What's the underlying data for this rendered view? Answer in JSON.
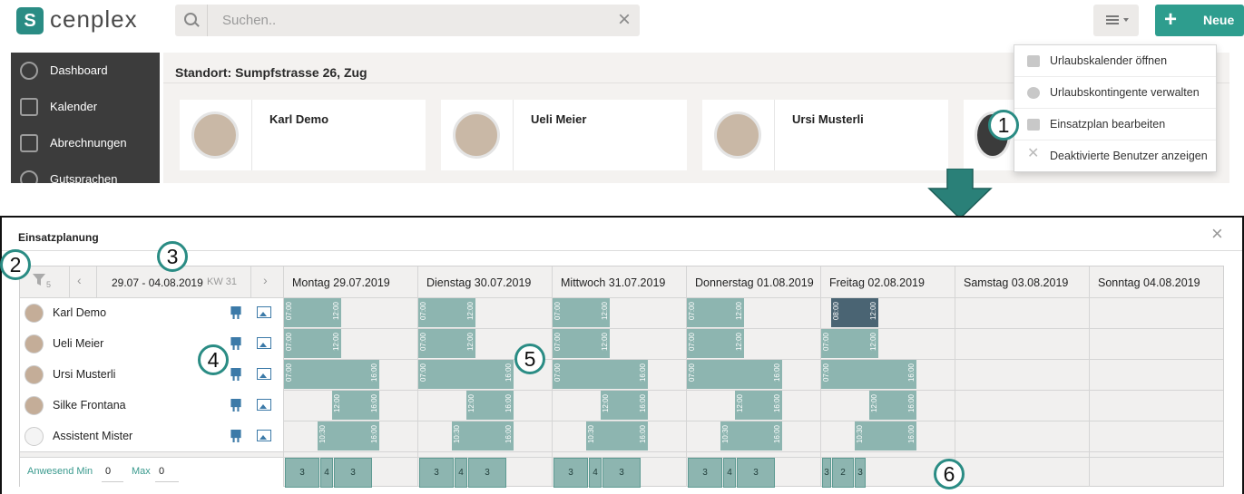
{
  "app": {
    "logo_text": "cenplex",
    "search_placeholder": "Suchen..",
    "new_label": "Neue"
  },
  "sidebar": {
    "items": [
      {
        "label": "Dashboard",
        "icon": "dashboard-icon"
      },
      {
        "label": "Kalender",
        "icon": "calendar-icon"
      },
      {
        "label": "Abrechnungen",
        "icon": "calculator-icon"
      },
      {
        "label": "Gutsprachen",
        "icon": "dollar-icon"
      }
    ]
  },
  "main": {
    "location": "Standort: Sumpfstrasse 26, Zug",
    "cards": [
      "Karl Demo",
      "Ueli  Meier",
      "Ursi Musterli"
    ]
  },
  "dropdown": {
    "items": [
      {
        "label": "Urlaubskalender öffnen",
        "icon": "calendar-icon"
      },
      {
        "label": "Urlaubskontingente verwalten",
        "icon": "gear-icon"
      },
      {
        "label": "Einsatzplan bearbeiten",
        "icon": "easel-icon"
      },
      {
        "label": "Deaktivierte Benutzer anzeigen",
        "icon": "close-icon"
      }
    ]
  },
  "badges": [
    "1",
    "2",
    "3",
    "4",
    "5",
    "6"
  ],
  "modal": {
    "title": "Einsatzplanung",
    "filter_count": "5",
    "date_range": "29.07 - 04.08.2019",
    "week": "KW 31",
    "days": [
      "Montag 29.07.2019",
      "Dienstag 30.07.2019",
      "Mittwoch 31.07.2019",
      "Donnerstag 01.08.2019",
      "Freitag 02.08.2019",
      "Samstag 03.08.2019",
      "Sonntag 04.08.2019"
    ],
    "employees": [
      {
        "name": "Karl Demo"
      },
      {
        "name": "Ueli  Meier"
      },
      {
        "name": "Ursi Musterli"
      },
      {
        "name": "Silke Frontana"
      },
      {
        "name": "Assistent Mister"
      }
    ],
    "present_min_label": "Anwesend Min",
    "present_min_value": "0",
    "max_label": "Max",
    "max_value": "0",
    "shifts": [
      {
        "row": 0,
        "day": 0,
        "start": "07:00",
        "end": "12:00"
      },
      {
        "row": 0,
        "day": 1,
        "start": "07:00",
        "end": "12:00"
      },
      {
        "row": 0,
        "day": 2,
        "start": "07:00",
        "end": "12:00"
      },
      {
        "row": 0,
        "day": 3,
        "start": "07:00",
        "end": "12:00"
      },
      {
        "row": 0,
        "day": 4,
        "start": "08:00",
        "end": "12:00",
        "dark": true
      },
      {
        "row": 1,
        "day": 0,
        "start": "07:00",
        "end": "12:00"
      },
      {
        "row": 1,
        "day": 1,
        "start": "07:00",
        "end": "12:00"
      },
      {
        "row": 1,
        "day": 2,
        "start": "07:00",
        "end": "12:00"
      },
      {
        "row": 1,
        "day": 3,
        "start": "07:00",
        "end": "12:00"
      },
      {
        "row": 1,
        "day": 4,
        "start": "07:00",
        "end": "12:00"
      },
      {
        "row": 2,
        "day": 0,
        "start": "07:00",
        "end": "16:00"
      },
      {
        "row": 2,
        "day": 1,
        "start": "07:00",
        "end": "16:00"
      },
      {
        "row": 2,
        "day": 2,
        "start": "07:00",
        "end": "16:00"
      },
      {
        "row": 2,
        "day": 3,
        "start": "07:00",
        "end": "16:00"
      },
      {
        "row": 2,
        "day": 4,
        "start": "07:00",
        "end": "16:00"
      },
      {
        "row": 3,
        "day": 0,
        "start": "12:00",
        "end": "16:00"
      },
      {
        "row": 3,
        "day": 1,
        "start": "12:00",
        "end": "16:00"
      },
      {
        "row": 3,
        "day": 2,
        "start": "12:00",
        "end": "16:00"
      },
      {
        "row": 3,
        "day": 3,
        "start": "12:00",
        "end": "16:00"
      },
      {
        "row": 3,
        "day": 4,
        "start": "12:00",
        "end": "16:00"
      },
      {
        "row": 4,
        "day": 0,
        "start": "10:30",
        "end": "16:00"
      },
      {
        "row": 4,
        "day": 1,
        "start": "10:30",
        "end": "16:00"
      },
      {
        "row": 4,
        "day": 2,
        "start": "10:30",
        "end": "16:00"
      },
      {
        "row": 4,
        "day": 3,
        "start": "10:30",
        "end": "16:00"
      },
      {
        "row": 4,
        "day": 4,
        "start": "10:30",
        "end": "16:00"
      }
    ],
    "counts": [
      [
        "3",
        "4",
        "3"
      ],
      [
        "3",
        "4",
        "3"
      ],
      [
        "3",
        "4",
        "3"
      ],
      [
        "3",
        "4",
        "3"
      ],
      [
        "3",
        "2",
        "3"
      ]
    ]
  }
}
